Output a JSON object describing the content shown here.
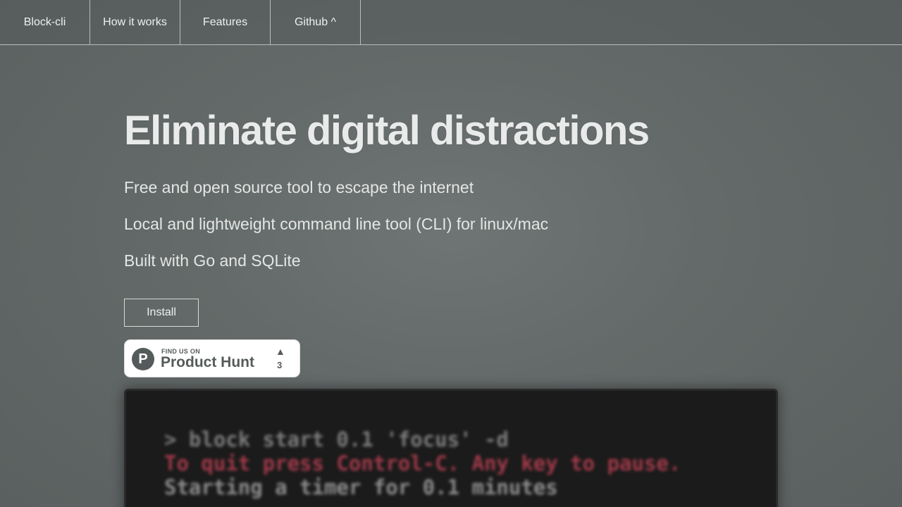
{
  "nav": {
    "items": [
      {
        "label": "Block-cli"
      },
      {
        "label": "How it works"
      },
      {
        "label": "Features"
      },
      {
        "label": "Github ^"
      }
    ]
  },
  "hero": {
    "title": "Eliminate digital distractions",
    "taglines": [
      "Free and open source tool to escape the internet",
      "Local and lightweight command line tool (CLI) for linux/mac",
      "Built with Go and SQLite"
    ],
    "install_label": "Install"
  },
  "product_hunt": {
    "small_text": "FIND US ON",
    "big_text": "Product Hunt",
    "arrow": "▲",
    "count": "3",
    "logo_letter": "P"
  },
  "terminal": {
    "lines": [
      "> block start 0.1 'focus' -d",
      "To quit press Control-C. Any key to pause.",
      "Starting a timer for 0.1 minutes"
    ]
  },
  "colors": {
    "background": "#646a69",
    "terminal_bg": "#1b1b1b",
    "warning_text": "#a13a4a"
  }
}
